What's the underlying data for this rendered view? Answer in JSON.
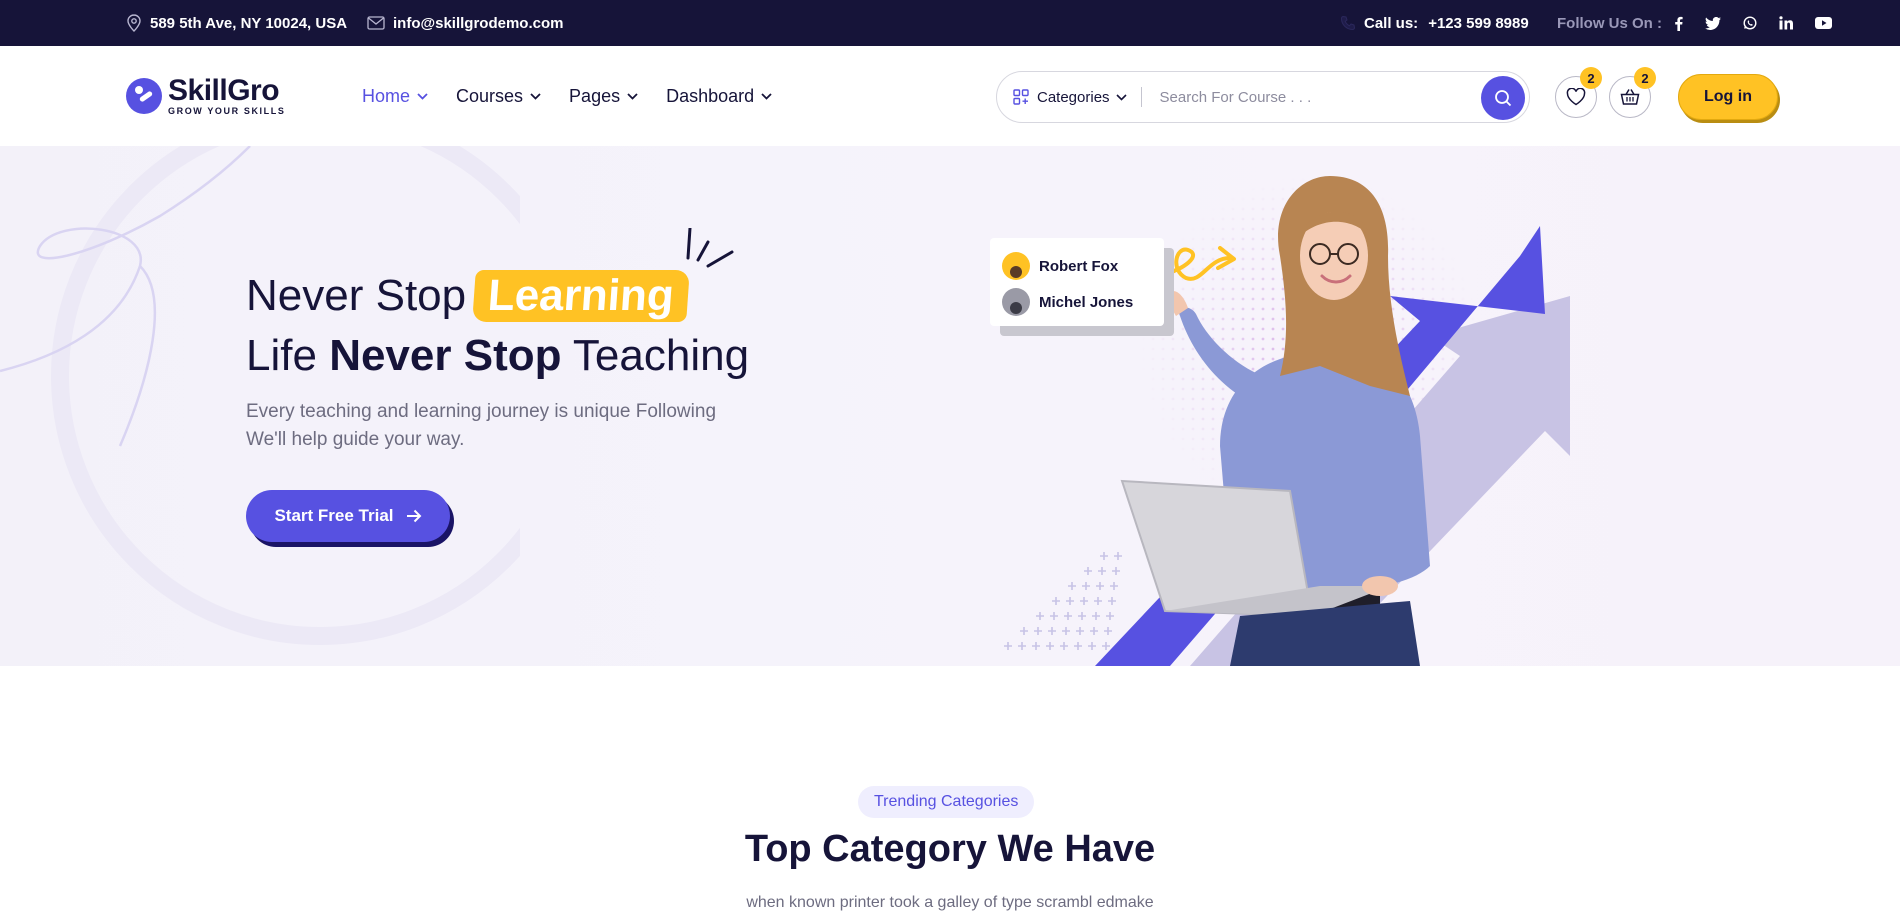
{
  "topbar": {
    "address": "589 5th Ave, NY 10024, USA",
    "email": "info@skillgrodemo.com",
    "call_label": "Call us:",
    "phone": "+123 599 8989",
    "follow_label": "Follow Us On :",
    "social_icons": [
      "facebook-icon",
      "twitter-icon",
      "whatsapp-icon",
      "linkedin-icon",
      "youtube-icon"
    ]
  },
  "brand": {
    "name": "SkillGro",
    "tagline": "GROW YOUR SKILLS",
    "accent": "#5751e1",
    "yellow": "#ffc224",
    "dark": "#161439"
  },
  "nav": {
    "items": [
      {
        "label": "Home"
      },
      {
        "label": "Courses"
      },
      {
        "label": "Pages"
      },
      {
        "label": "Dashboard"
      }
    ]
  },
  "search": {
    "categories_label": "Categories",
    "placeholder": "Search For Course . . ."
  },
  "header_actions": {
    "wishlist_count": "2",
    "cart_count": "2",
    "login_label": "Log in"
  },
  "hero": {
    "title_part1": "Never Stop",
    "title_highlight": "Learning",
    "title_line2_part1": "Life",
    "title_line2_bold": "Never Stop",
    "title_line2_part2": "Teaching",
    "description": "Every teaching and learning journey is unique Following We'll help guide your way.",
    "cta_label": "Start Free Trial",
    "people": [
      {
        "name": "Robert Fox"
      },
      {
        "name": "Michel Jones"
      }
    ]
  },
  "categories_section": {
    "pill": "Trending Categories",
    "title": "Top Category We Have",
    "subtitle": "when known printer took a galley of type scrambl edmake"
  }
}
